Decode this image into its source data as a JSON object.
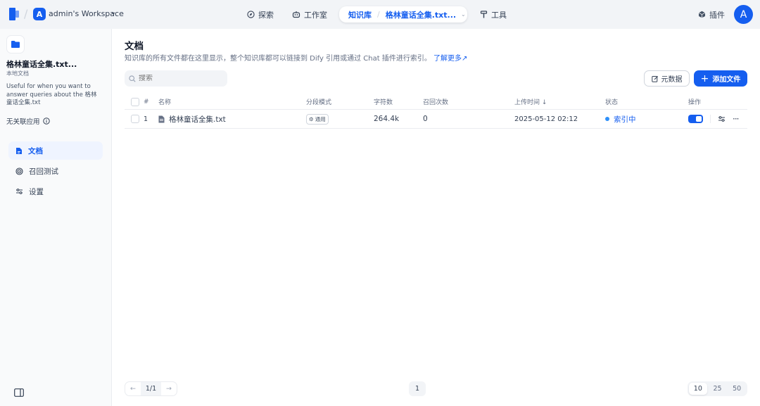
{
  "topbar": {
    "workspace_initial": "A",
    "workspace_name": "admin's Workspace",
    "nav": {
      "explore": "探索",
      "studio": "工作室",
      "knowledge": "知识库",
      "dataset_name": "格林童话全集.txt...",
      "tools": "工具",
      "plugins": "插件"
    },
    "user_initial": "A"
  },
  "sidebar": {
    "dataset_name": "格林童话全集.txt...",
    "dataset_type": "本地文档",
    "description": "Useful for when you want to answer queries about the 格林童话全集.txt",
    "unlinked": "无关联应用",
    "items": {
      "documents": "文档",
      "hit_testing": "召回测试",
      "settings": "设置"
    }
  },
  "main": {
    "title": "文档",
    "subtitle": "知识库的所有文件都在这里显示，整个知识库都可以链接到 Dify 引用或通过 Chat 插件进行索引。",
    "learn_more": "了解更多",
    "search_placeholder": "搜索",
    "metadata_button": "元数据",
    "add_file_button": "添加文件",
    "columns": {
      "index": "#",
      "name": "名称",
      "chunk_mode": "分段模式",
      "char_count": "字符数",
      "hit_count": "召回次数",
      "upload_time": "上传时间 ↓",
      "status": "状态",
      "action": "操作"
    },
    "rows": [
      {
        "index": "1",
        "name": "格林童话全集.txt",
        "chunk_mode": "通用",
        "char_count": "264.4k",
        "hit_count": "0",
        "upload_time": "2025-05-12 02:12",
        "status": "索引中",
        "enabled": true
      }
    ],
    "pagination": {
      "page_indicator": "1/1",
      "current_page": "1",
      "sizes": [
        "10",
        "25",
        "50"
      ],
      "selected_size": "10"
    }
  },
  "colors": {
    "accent": "#155eef",
    "status_dot": "#2e90fa"
  }
}
